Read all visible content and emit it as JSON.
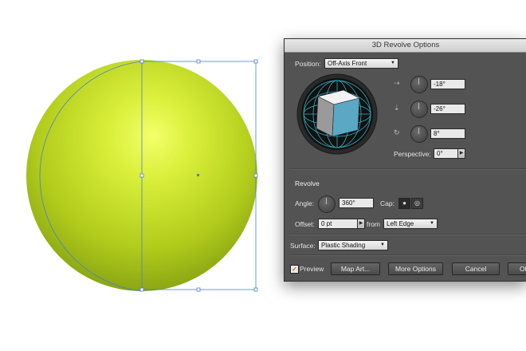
{
  "dialog": {
    "title": "3D Revolve Options",
    "position_label": "Position:",
    "position_value": "Off-Axis Front",
    "rotation": {
      "x": "-18°",
      "y": "-26°",
      "z": "8°"
    },
    "perspective_label": "Perspective:",
    "perspective_value": "0°",
    "revolve": {
      "section": "Revolve",
      "angle_label": "Angle:",
      "angle_value": "360°",
      "cap_label": "Cap:",
      "offset_label": "Offset:",
      "offset_value": "0 pt",
      "from_label": "from",
      "from_value": "Left Edge"
    },
    "surface_label": "Surface:",
    "surface_value": "Plastic Shading",
    "buttons": {
      "preview": "Preview",
      "map_art": "Map Art...",
      "more_options": "More Options",
      "cancel": "Cancel",
      "ok": "OK"
    },
    "preview_checked": true
  },
  "colors": {
    "sphere_highlight": "#f4ff6a",
    "sphere_mid": "#b8d41a",
    "sphere_dark": "#7c9810",
    "selection": "#4a7fd6",
    "cube_side": "#5aa8c4",
    "track_lines": "#2fc4d6"
  }
}
